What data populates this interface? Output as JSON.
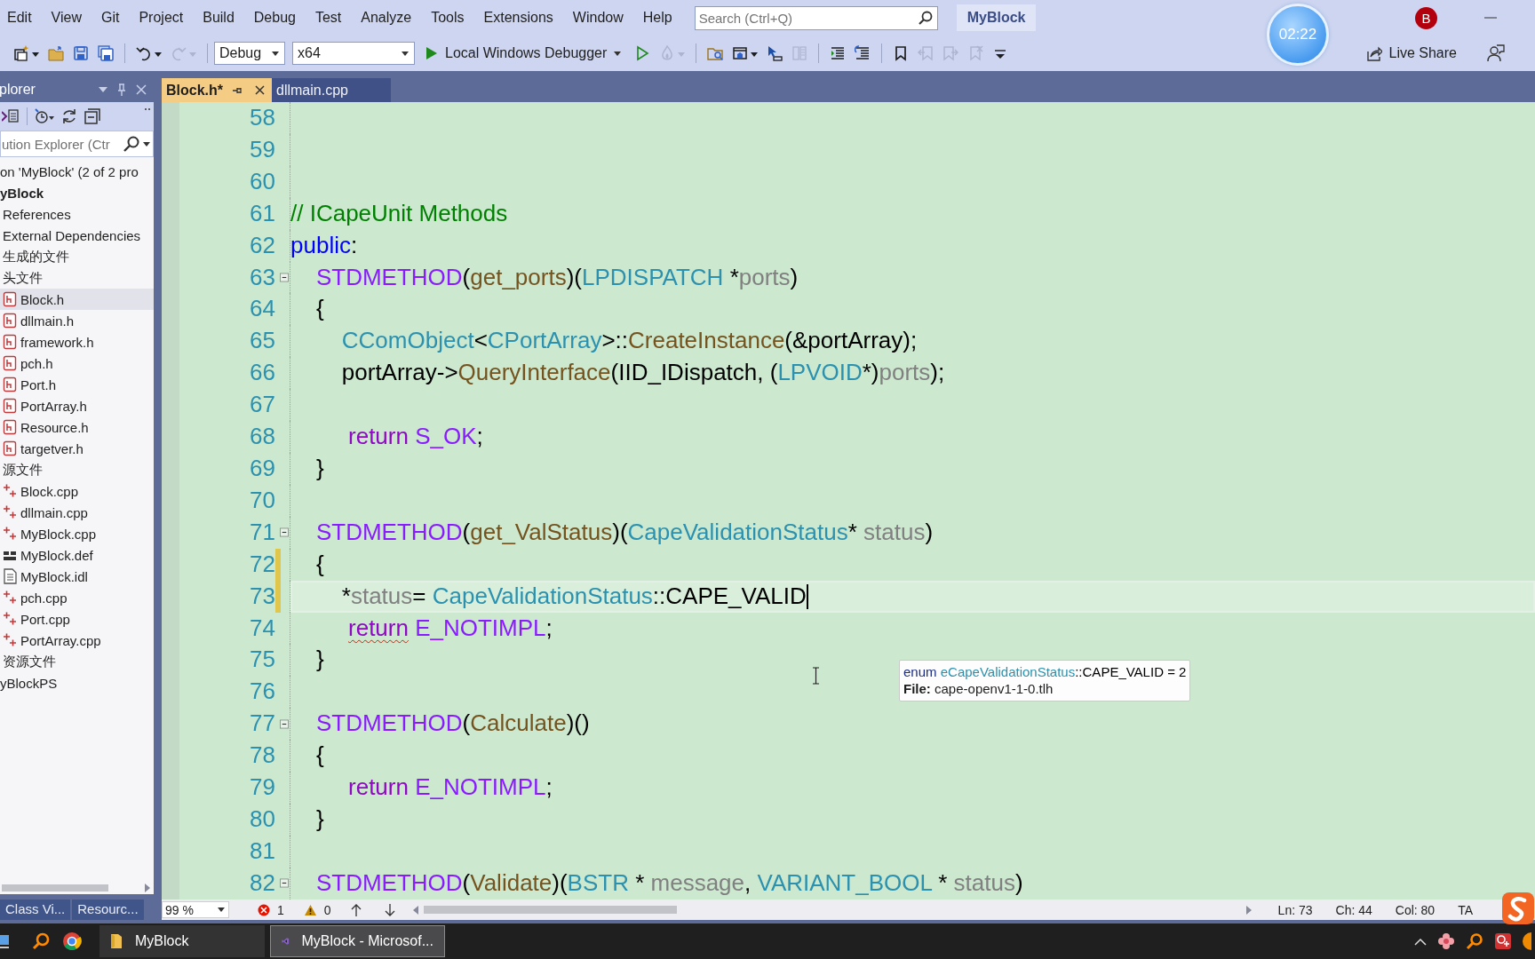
{
  "menu_bar": {
    "items": [
      "Edit",
      "View",
      "Git",
      "Project",
      "Build",
      "Debug",
      "Test",
      "Analyze",
      "Tools",
      "Extensions",
      "Window",
      "Help"
    ],
    "search": {
      "placeholder": "Search (Ctrl+Q)"
    },
    "solution_name": "MyBlock",
    "avatar": "B"
  },
  "timer": "02:22",
  "toolbar": {
    "items": [
      {
        "kind": "new-item",
        "dropdown": true,
        "disabled": false
      },
      {
        "kind": "open",
        "dropdown": false,
        "disabled": false
      },
      {
        "kind": "save",
        "dropdown": false,
        "disabled": false
      },
      {
        "kind": "save-all",
        "dropdown": false,
        "disabled": false
      },
      {
        "kind": "separator"
      },
      {
        "kind": "undo",
        "dropdown": true,
        "disabled": false
      },
      {
        "kind": "redo",
        "dropdown": true,
        "disabled": true
      },
      {
        "kind": "separator"
      },
      {
        "kind": "config",
        "value": "Debug"
      },
      {
        "kind": "platform",
        "value": "x64"
      },
      {
        "kind": "start",
        "label": "Local Windows Debugger",
        "dropdown": true
      },
      {
        "kind": "start-without-debug",
        "dropdown": false,
        "disabled": false
      },
      {
        "kind": "hot-reload",
        "dropdown": true,
        "disabled": true
      },
      {
        "kind": "separator"
      },
      {
        "kind": "find-folder",
        "dropdown": false,
        "disabled": false
      },
      {
        "kind": "window",
        "dropdown": true,
        "disabled": false
      },
      {
        "kind": "pointer",
        "dropdown": false,
        "disabled": false
      },
      {
        "kind": "columns",
        "dropdown": false,
        "disabled": true
      },
      {
        "kind": "separator"
      },
      {
        "kind": "indent",
        "dropdown": false,
        "disabled": false
      },
      {
        "kind": "outdent",
        "dropdown": false,
        "disabled": false
      },
      {
        "kind": "separator"
      },
      {
        "kind": "bookmark",
        "dropdown": false,
        "disabled": false
      },
      {
        "kind": "bookmark-prev",
        "dropdown": false,
        "disabled": true
      },
      {
        "kind": "bookmark-next",
        "dropdown": false,
        "disabled": true
      },
      {
        "kind": "bookmark-clear",
        "dropdown": false,
        "disabled": true
      },
      {
        "kind": "overflow",
        "dropdown": false,
        "disabled": false
      }
    ],
    "live_share": "Live Share"
  },
  "solution_explorer": {
    "title": "plorer",
    "search": {
      "placeholder": "ution Explorer (Ctr"
    },
    "tree": [
      {
        "label": "on 'MyBlock' (2 of 2 pro",
        "selected": false,
        "children": [
          {
            "label": "yBlock",
            "kind": "project",
            "startup": true,
            "selected": false,
            "children": [
              {
                "label": "References",
                "selected": false
              },
              {
                "label": "External Dependencies",
                "selected": false
              },
              {
                "label": "生成的文件",
                "selected": false
              },
              {
                "label": "头文件",
                "selected": false,
                "children": [
                  {
                    "label": "Block.h",
                    "kind": "header",
                    "selected": true
                  },
                  {
                    "label": "dllmain.h",
                    "kind": "header",
                    "selected": false
                  },
                  {
                    "label": "framework.h",
                    "kind": "header",
                    "selected": false
                  },
                  {
                    "label": "pch.h",
                    "kind": "header",
                    "selected": false
                  },
                  {
                    "label": "Port.h",
                    "kind": "header",
                    "selected": false
                  },
                  {
                    "label": "PortArray.h",
                    "kind": "header",
                    "selected": false
                  },
                  {
                    "label": "Resource.h",
                    "kind": "header",
                    "selected": false
                  },
                  {
                    "label": "targetver.h",
                    "kind": "header",
                    "selected": false
                  }
                ]
              },
              {
                "label": "源文件",
                "selected": false,
                "children": [
                  {
                    "label": "Block.cpp",
                    "kind": "source",
                    "selected": false
                  },
                  {
                    "label": "dllmain.cpp",
                    "kind": "source",
                    "selected": false
                  },
                  {
                    "label": "MyBlock.cpp",
                    "kind": "source",
                    "selected": false
                  },
                  {
                    "label": "MyBlock.def",
                    "kind": "def",
                    "selected": false
                  },
                  {
                    "label": "MyBlock.idl",
                    "kind": "idl",
                    "selected": false
                  },
                  {
                    "label": "pch.cpp",
                    "kind": "source",
                    "selected": false
                  },
                  {
                    "label": "Port.cpp",
                    "kind": "source",
                    "selected": false
                  },
                  {
                    "label": "PortArray.cpp",
                    "kind": "source",
                    "selected": false
                  }
                ]
              },
              {
                "label": "资源文件",
                "selected": false
              }
            ]
          },
          {
            "label": "yBlockPS",
            "kind": "project",
            "startup": false,
            "selected": false
          }
        ]
      }
    ],
    "tabs": [
      {
        "label": "Class Vi...",
        "selected": false
      },
      {
        "label": "Resourc...",
        "selected": false
      }
    ]
  },
  "editor": {
    "tabs": [
      {
        "label": "Block.h*",
        "selected": true,
        "pinned": true
      },
      {
        "label": "dllmain.cpp",
        "selected": false,
        "pinned": false
      }
    ],
    "lines": [
      {
        "number": "58",
        "collapsible": false,
        "modified": false,
        "current": false
      },
      {
        "number": "59",
        "collapsible": false,
        "modified": false,
        "current": false
      },
      {
        "number": "60",
        "collapsible": false,
        "modified": false,
        "current": false
      },
      {
        "number": "61",
        "collapsible": false,
        "modified": false,
        "current": false,
        "tokens": [
          {
            "kind": "comment",
            "text": "// ICapeUnit Methods"
          }
        ]
      },
      {
        "number": "62",
        "collapsible": false,
        "modified": false,
        "current": false,
        "tokens": [
          {
            "kind": "keyword",
            "text": "public"
          },
          {
            "kind": "plain",
            "text": ":"
          }
        ]
      },
      {
        "number": "63",
        "collapsible": true,
        "modified": false,
        "current": false,
        "tokens": [
          {
            "kind": "macro",
            "text": "    STDMETHOD"
          },
          {
            "kind": "plain",
            "text": "("
          },
          {
            "kind": "function",
            "text": "get_ports"
          },
          {
            "kind": "plain",
            "text": ")("
          },
          {
            "kind": "type",
            "text": "LPDISPATCH"
          },
          {
            "kind": "plain",
            "text": " *"
          },
          {
            "kind": "param",
            "text": "ports"
          },
          {
            "kind": "plain",
            "text": ")"
          }
        ]
      },
      {
        "number": "64",
        "collapsible": false,
        "modified": false,
        "current": false,
        "tokens": [
          {
            "kind": "plain",
            "text": "    {"
          }
        ]
      },
      {
        "number": "65",
        "collapsible": false,
        "modified": false,
        "current": false,
        "tokens": [
          {
            "kind": "type",
            "text": "        CComObject"
          },
          {
            "kind": "plain",
            "text": "<"
          },
          {
            "kind": "type",
            "text": "CPortArray"
          },
          {
            "kind": "plain",
            "text": ">::"
          },
          {
            "kind": "function",
            "text": "CreateInstance"
          },
          {
            "kind": "plain",
            "text": "(&portArray);"
          }
        ]
      },
      {
        "number": "66",
        "collapsible": false,
        "modified": false,
        "current": false,
        "tokens": [
          {
            "kind": "plain",
            "text": "        portArray->"
          },
          {
            "kind": "function",
            "text": "QueryInterface"
          },
          {
            "kind": "plain",
            "text": "(IID_IDispatch, ("
          },
          {
            "kind": "type",
            "text": "LPVOID"
          },
          {
            "kind": "plain",
            "text": "*)"
          },
          {
            "kind": "param",
            "text": "ports"
          },
          {
            "kind": "plain",
            "text": ");"
          }
        ]
      },
      {
        "number": "67",
        "collapsible": false,
        "modified": false,
        "current": false
      },
      {
        "number": "68",
        "collapsible": false,
        "modified": false,
        "current": false,
        "tokens": [
          {
            "kind": "control",
            "text": "         return"
          },
          {
            "kind": "macro",
            "text": " S_OK"
          },
          {
            "kind": "plain",
            "text": ";"
          }
        ]
      },
      {
        "number": "69",
        "collapsible": false,
        "modified": false,
        "current": false,
        "tokens": [
          {
            "kind": "plain",
            "text": "    }"
          }
        ]
      },
      {
        "number": "70",
        "collapsible": false,
        "modified": false,
        "current": false
      },
      {
        "number": "71",
        "collapsible": true,
        "modified": false,
        "current": false,
        "tokens": [
          {
            "kind": "macro",
            "text": "    STDMETHOD"
          },
          {
            "kind": "plain",
            "text": "("
          },
          {
            "kind": "function",
            "text": "get_ValStatus"
          },
          {
            "kind": "plain",
            "text": ")("
          },
          {
            "kind": "type",
            "text": "CapeValidationStatus"
          },
          {
            "kind": "plain",
            "text": "* "
          },
          {
            "kind": "param",
            "text": "status"
          },
          {
            "kind": "plain",
            "text": ")"
          }
        ]
      },
      {
        "number": "72",
        "collapsible": false,
        "modified": true,
        "current": false,
        "tokens": [
          {
            "kind": "plain",
            "text": "    {"
          }
        ]
      },
      {
        "number": "73",
        "collapsible": false,
        "modified": true,
        "current": true,
        "tokens": [
          {
            "kind": "plain",
            "text": "        *"
          },
          {
            "kind": "param",
            "text": "status"
          },
          {
            "kind": "plain",
            "text": "= "
          },
          {
            "kind": "type",
            "text": "CapeValidationStatus"
          },
          {
            "kind": "plain",
            "text": "::CAPE_VALID"
          }
        ]
      },
      {
        "number": "74",
        "collapsible": false,
        "modified": false,
        "current": false,
        "tokens": [
          {
            "kind": "control",
            "text": "         return",
            "squiggle": true
          },
          {
            "kind": "macro",
            "text": " E_NOTIMPL"
          },
          {
            "kind": "plain",
            "text": ";"
          }
        ]
      },
      {
        "number": "75",
        "collapsible": false,
        "modified": false,
        "current": false,
        "tokens": [
          {
            "kind": "plain",
            "text": "    }"
          }
        ]
      },
      {
        "number": "76",
        "collapsible": false,
        "modified": false,
        "current": false
      },
      {
        "number": "77",
        "collapsible": true,
        "modified": false,
        "current": false,
        "tokens": [
          {
            "kind": "macro",
            "text": "    STDMETHOD"
          },
          {
            "kind": "plain",
            "text": "("
          },
          {
            "kind": "function",
            "text": "Calculate"
          },
          {
            "kind": "plain",
            "text": ")()"
          }
        ]
      },
      {
        "number": "78",
        "collapsible": false,
        "modified": false,
        "current": false,
        "tokens": [
          {
            "kind": "plain",
            "text": "    {"
          }
        ]
      },
      {
        "number": "79",
        "collapsible": false,
        "modified": false,
        "current": false,
        "tokens": [
          {
            "kind": "control",
            "text": "         return"
          },
          {
            "kind": "macro",
            "text": " E_NOTIMPL"
          },
          {
            "kind": "plain",
            "text": ";"
          }
        ]
      },
      {
        "number": "80",
        "collapsible": false,
        "modified": false,
        "current": false,
        "tokens": [
          {
            "kind": "plain",
            "text": "    }"
          }
        ]
      },
      {
        "number": "81",
        "collapsible": false,
        "modified": false,
        "current": false
      },
      {
        "number": "82",
        "collapsible": true,
        "modified": false,
        "current": false,
        "tokens": [
          {
            "kind": "macro",
            "text": "    STDMETHOD"
          },
          {
            "kind": "plain",
            "text": "("
          },
          {
            "kind": "function",
            "text": "Validate"
          },
          {
            "kind": "plain",
            "text": ")("
          },
          {
            "kind": "type",
            "text": "BSTR"
          },
          {
            "kind": "plain",
            "text": " * "
          },
          {
            "kind": "param",
            "text": "message"
          },
          {
            "kind": "plain",
            "text": ", "
          },
          {
            "kind": "type",
            "text": "VARIANT_BOOL"
          },
          {
            "kind": "plain",
            "text": " * "
          },
          {
            "kind": "param",
            "text": "status"
          },
          {
            "kind": "plain",
            "text": ")"
          }
        ]
      }
    ],
    "tooltip": {
      "signature": [
        {
          "kind": "keyword_dark",
          "text": "enum "
        },
        {
          "kind": "type",
          "text": "eCapeValidationStatus"
        },
        {
          "kind": "plain",
          "text": "::CAPE_VALID = 2"
        }
      ],
      "file": "**File:** cape-openv1-1-0.tlh"
    }
  },
  "status_bar": {
    "zoom": "99 %",
    "errors": "1",
    "warnings": "0",
    "line": "Ln: 73",
    "char": "Ch: 44",
    "column": "Col: 80",
    "mode": "TA"
  },
  "taskbar": {
    "buttons": [
      {
        "label": "MyBlock",
        "kind": "folder",
        "selected": false
      },
      {
        "label": "MyBlock - Microsof...",
        "kind": "ide",
        "selected": true
      }
    ]
  }
}
